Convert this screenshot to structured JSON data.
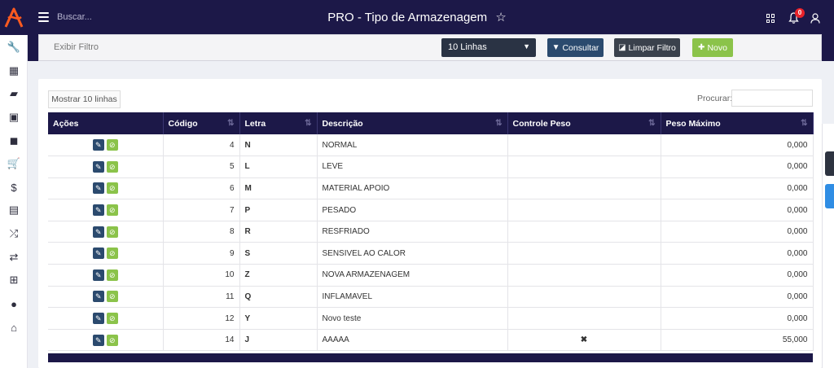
{
  "header": {
    "search_placeholder": "Buscar...",
    "title": "PRO - Tipo de Armazenagem",
    "notification_count": "0"
  },
  "filter": {
    "toggle_label": "Exibir Filtro",
    "lines_value": "10 Linhas",
    "consultar_label": "Consultar",
    "limpar_label": "Limpar Filtro",
    "novo_label": "Novo"
  },
  "table": {
    "show_lines_label": "Mostrar 10 linhas",
    "search_label": "Procurar:",
    "columns": [
      "Ações",
      "Código",
      "Letra",
      "Descrição",
      "Controle Peso",
      "Peso Máximo"
    ],
    "rows": [
      {
        "codigo": "4",
        "letra": "N",
        "descricao": "NORMAL",
        "controle": "",
        "peso": "0,000"
      },
      {
        "codigo": "5",
        "letra": "L",
        "descricao": "LEVE",
        "controle": "",
        "peso": "0,000"
      },
      {
        "codigo": "6",
        "letra": "M",
        "descricao": "MATERIAL APOIO",
        "controle": "",
        "peso": "0,000"
      },
      {
        "codigo": "7",
        "letra": "P",
        "descricao": "PESADO",
        "controle": "",
        "peso": "0,000"
      },
      {
        "codigo": "8",
        "letra": "R",
        "descricao": "RESFRIADO",
        "controle": "",
        "peso": "0,000"
      },
      {
        "codigo": "9",
        "letra": "S",
        "descricao": "SENSIVEL AO CALOR",
        "controle": "",
        "peso": "0,000"
      },
      {
        "codigo": "10",
        "letra": "Z",
        "descricao": "NOVA ARMAZENAGEM",
        "controle": "",
        "peso": "0,000"
      },
      {
        "codigo": "11",
        "letra": "Q",
        "descricao": "INFLAMAVEL",
        "controle": "",
        "peso": "0,000"
      },
      {
        "codigo": "12",
        "letra": "Y",
        "descricao": "Novo teste",
        "controle": "",
        "peso": "0,000"
      },
      {
        "codigo": "14",
        "letra": "J",
        "descricao": "AAAAA",
        "controle": "✖",
        "peso": "55,000"
      }
    ]
  },
  "icons": {
    "sidebar": [
      "wrench-icon",
      "calculator-icon",
      "book-icon",
      "money-icon",
      "briefcase-icon",
      "cart-icon",
      "dollar-icon",
      "table-icon",
      "shuffle-icon",
      "retweet-icon",
      "basket-icon",
      "user-icon",
      "home-icon"
    ]
  },
  "colors": {
    "navy": "#1c1848",
    "accent_orange": "#ff5a1f",
    "button_blue": "#2b4a6e",
    "button_green": "#8bc34a",
    "badge_red": "#e8222a"
  }
}
